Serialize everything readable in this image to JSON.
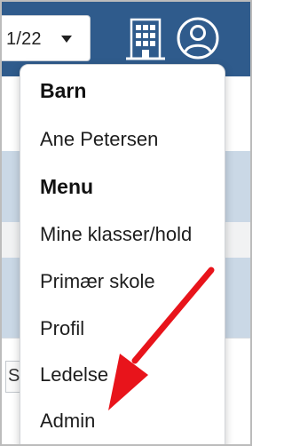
{
  "header": {
    "period_select": {
      "value": "1/22"
    },
    "icons": {
      "building": "building-icon",
      "user": "user-account-icon"
    },
    "colors": {
      "topbar": "#2f5b8c"
    }
  },
  "background": {
    "partial_field_char": "S"
  },
  "dropdown": {
    "sections": [
      {
        "heading": "Barn",
        "items": [
          "Ane Petersen"
        ]
      },
      {
        "heading": "Menu",
        "items": [
          "Mine klasser/hold",
          "Primær skole",
          "Profil",
          "Ledelse",
          "Admin"
        ]
      }
    ]
  },
  "annotation": {
    "arrow_color": "#e8141b",
    "points_to": "Admin"
  }
}
